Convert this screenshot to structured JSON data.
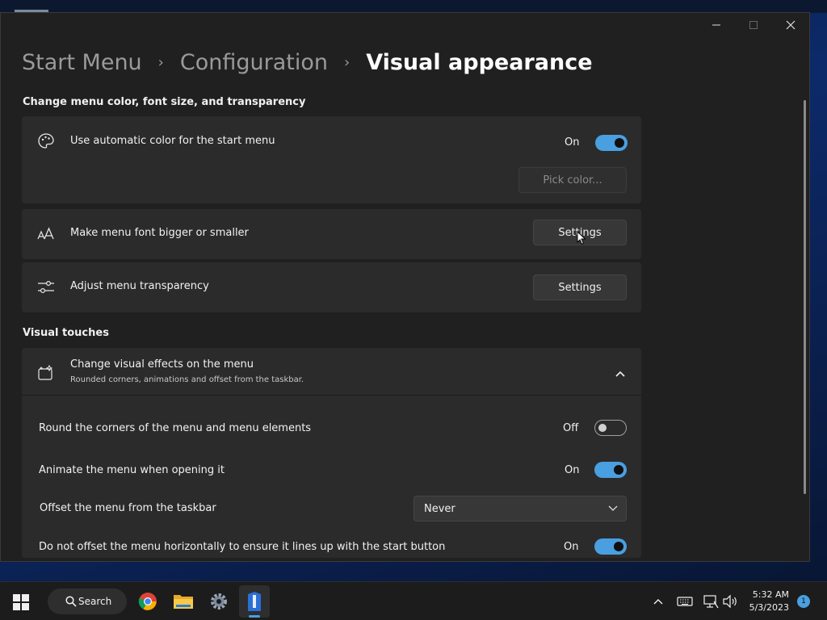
{
  "window": {
    "minimize_icon": "minimize-icon",
    "maximize_icon": "maximize-icon",
    "close_icon": "close-icon"
  },
  "breadcrumb": {
    "items": [
      "Start Menu",
      "Configuration",
      "Visual appearance"
    ],
    "separator": "›"
  },
  "sections": {
    "appearance_title": "Change menu color, font size, and transparency",
    "visual_touches_title": "Visual touches"
  },
  "auto_color": {
    "label": "Use automatic color for the start menu",
    "state_label": "On",
    "enabled": true,
    "pick_color_label": "Pick color...",
    "icon": "palette-icon"
  },
  "font_size": {
    "label": "Make menu font bigger or smaller",
    "button_label": "Settings",
    "icon": "font-size-icon"
  },
  "transparency": {
    "label": "Adjust menu transparency",
    "button_label": "Settings",
    "icon": "sliders-icon"
  },
  "visual_effects": {
    "label": "Change visual effects on the menu",
    "sublabel": "Rounded corners, animations and offset from the taskbar.",
    "icon": "effects-icon",
    "expanded": true,
    "options": [
      {
        "label": "Round the corners of the menu and menu elements",
        "state_label": "Off",
        "enabled": false
      },
      {
        "label": "Animate the menu when opening it",
        "state_label": "On",
        "enabled": true
      }
    ],
    "offset": {
      "label": "Offset the menu from the taskbar",
      "selected": "Never"
    },
    "no_horizontal_offset": {
      "label": "Do not offset the menu horizontally to ensure it lines up with the start button",
      "state_label": "On",
      "enabled": true
    }
  },
  "colors": {
    "accent": "#4a9fe0",
    "window_bg": "#202020",
    "card_bg": "#2b2b2b"
  },
  "taskbar": {
    "search_label": "Search",
    "time": "5:32 AM",
    "date": "5/3/2023",
    "notification_count": "1",
    "apps": [
      "start-icon",
      "chrome-icon",
      "file-explorer-icon",
      "settings-icon",
      "app-icon"
    ]
  }
}
